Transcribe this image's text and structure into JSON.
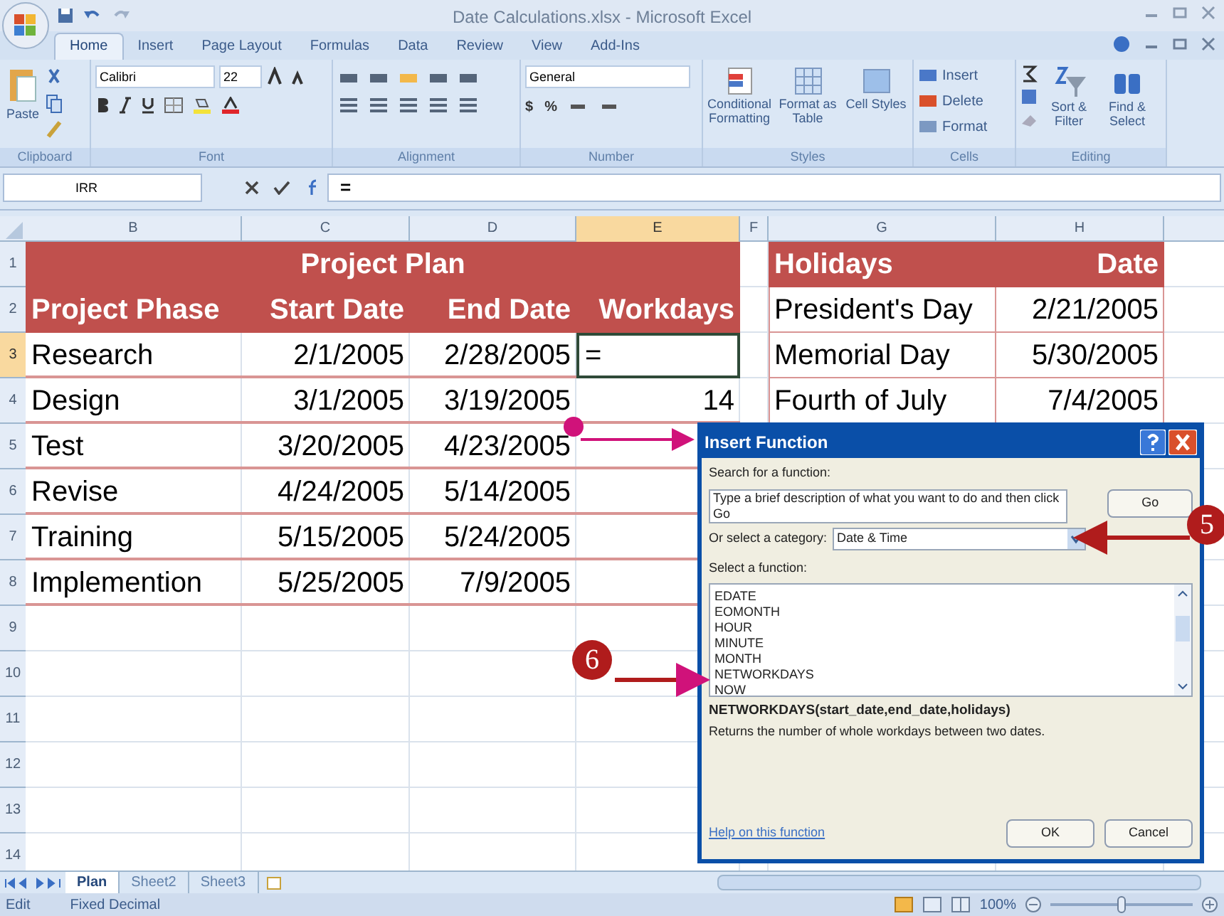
{
  "window": {
    "title": "Date Calculations.xlsx - Microsoft Excel"
  },
  "ribbon": {
    "tabs": [
      {
        "label": "Home",
        "selected": true
      },
      {
        "label": "Insert",
        "selected": false
      },
      {
        "label": "Page Layout",
        "selected": false
      },
      {
        "label": "Formulas",
        "selected": false
      },
      {
        "label": "Data",
        "selected": false
      },
      {
        "label": "Review",
        "selected": false
      },
      {
        "label": "View",
        "selected": false
      },
      {
        "label": "Add-Ins",
        "selected": false
      }
    ],
    "clipboard": {
      "label": "Clipboard",
      "paste": "Paste"
    },
    "font": {
      "label": "Font",
      "family": "Calibri",
      "size": "22"
    },
    "alignment": {
      "label": "Alignment"
    },
    "number": {
      "label": "Number",
      "format": "General",
      "currency": "$",
      "percent": "%"
    },
    "styles": {
      "label": "Styles",
      "buttons": [
        "Conditional Formatting",
        "Format as Table",
        "Cell Styles"
      ]
    },
    "cells": {
      "label": "Cells",
      "buttons": [
        "Insert",
        "Delete",
        "Format"
      ]
    },
    "editing": {
      "label": "Editing",
      "buttons": [
        "Sort & Filter",
        "Find & Select"
      ]
    }
  },
  "formula_bar": {
    "name_box": "IRR",
    "formula": "="
  },
  "columns": [
    {
      "label": "B",
      "selected": false
    },
    {
      "label": "C",
      "selected": false
    },
    {
      "label": "D",
      "selected": false
    },
    {
      "label": "E",
      "selected": true
    },
    {
      "label": "F",
      "selected": false
    },
    {
      "label": "G",
      "selected": false
    },
    {
      "label": "H",
      "selected": false
    }
  ],
  "row_headers": [
    {
      "label": "1",
      "selected": false
    },
    {
      "label": "2",
      "selected": false
    },
    {
      "label": "3",
      "selected": true
    },
    {
      "label": "4",
      "selected": false
    },
    {
      "label": "5",
      "selected": false
    },
    {
      "label": "6",
      "selected": false
    },
    {
      "label": "7",
      "selected": false
    },
    {
      "label": "8",
      "selected": false
    },
    {
      "label": "9",
      "selected": false
    },
    {
      "label": "10",
      "selected": false
    },
    {
      "label": "11",
      "selected": false
    },
    {
      "label": "12",
      "selected": false
    },
    {
      "label": "13",
      "selected": false
    },
    {
      "label": "14",
      "selected": false
    }
  ],
  "project_table": {
    "title": "Project Plan",
    "headers": [
      "Project Phase",
      "Start Date",
      "End Date",
      "Workdays"
    ],
    "rows": [
      {
        "phase": "Research",
        "start": "2/1/2005",
        "end": "2/28/2005",
        "workdays": "=",
        "editing": true
      },
      {
        "phase": "Design",
        "start": "3/1/2005",
        "end": "3/19/2005",
        "workdays": "14",
        "editing": false
      },
      {
        "phase": "Test",
        "start": "3/20/2005",
        "end": "4/23/2005",
        "editing": false
      },
      {
        "phase": "Revise",
        "start": "4/24/2005",
        "end": "5/14/2005",
        "editing": false
      },
      {
        "phase": "Training",
        "start": "5/15/2005",
        "end": "5/24/2005",
        "editing": false
      },
      {
        "phase": "Implemention",
        "start": "5/25/2005",
        "end": "7/9/2005",
        "editing": false
      }
    ]
  },
  "holidays_table": {
    "headers": [
      "Holidays",
      "Date"
    ],
    "rows": [
      {
        "name": "President's Day",
        "date": "2/21/2005"
      },
      {
        "name": "Memorial Day",
        "date": "5/30/2005"
      },
      {
        "name": "Fourth of July",
        "date": "7/4/2005"
      }
    ]
  },
  "dialog": {
    "title": "Insert Function",
    "search_label": "Search for a function:",
    "search_value": "Type a brief description of what you want to do and then click Go",
    "go": "Go",
    "category_label": "Or select a category:",
    "category": "Date & Time",
    "function_label": "Select a function:",
    "functions": [
      {
        "label": "EDATE",
        "selected": false
      },
      {
        "label": "EOMONTH",
        "selected": false
      },
      {
        "label": "HOUR",
        "selected": false
      },
      {
        "label": "MINUTE",
        "selected": false
      },
      {
        "label": "MONTH",
        "selected": false
      },
      {
        "label": "NETWORKDAYS",
        "selected": false
      },
      {
        "label": "NOW",
        "selected": false
      }
    ],
    "signature": "NETWORKDAYS(start_date,end_date,holidays)",
    "description": "Returns the number of whole workdays between two dates.",
    "help_link": "Help on this function",
    "ok": "OK",
    "cancel": "Cancel"
  },
  "callouts": [
    {
      "label": "5"
    },
    {
      "label": "6"
    }
  ],
  "sheet_tabs": [
    {
      "label": "Plan",
      "selected": true
    },
    {
      "label": "Sheet2",
      "selected": false
    },
    {
      "label": "Sheet3",
      "selected": false
    }
  ],
  "status_bar": {
    "mode": "Edit",
    "fixed_decimal": "Fixed Decimal",
    "zoom": "100%",
    "zoom_slider": {
      "level": 0.5
    }
  }
}
